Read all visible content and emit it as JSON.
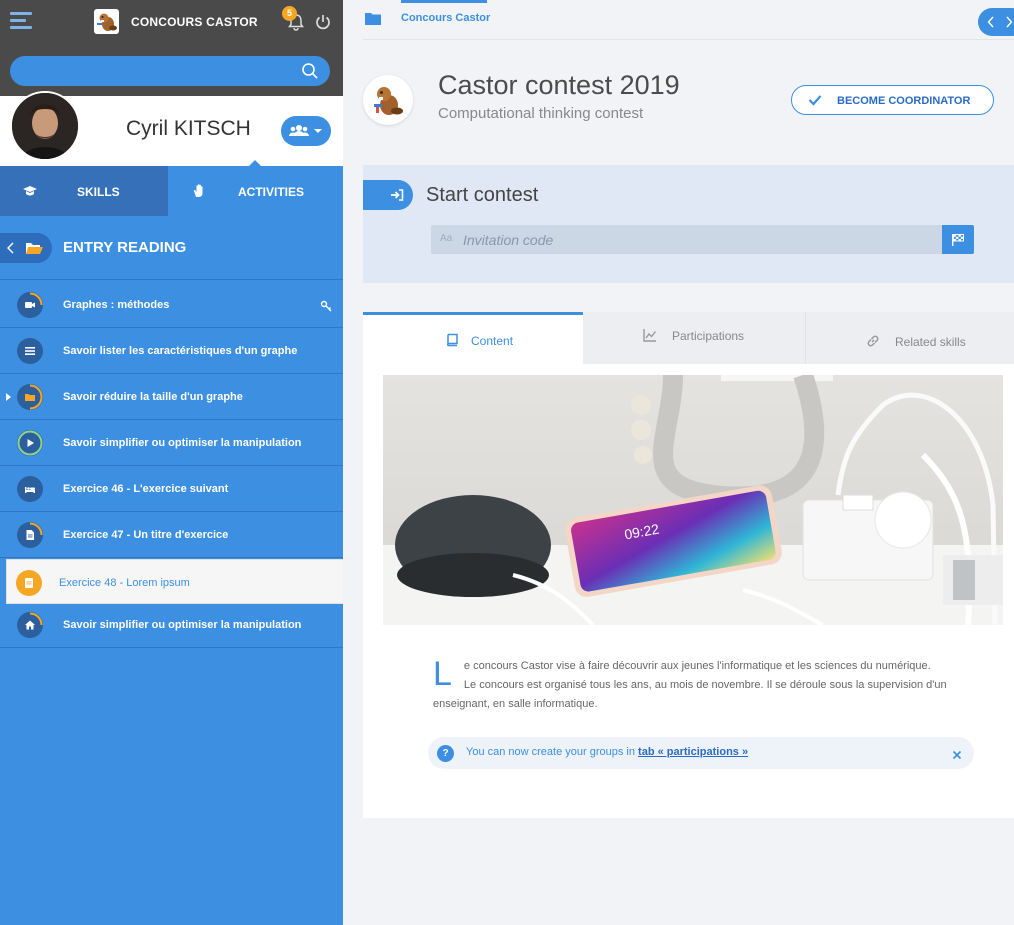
{
  "app": {
    "title": "CONCOURS CASTOR",
    "notification_count": "5"
  },
  "search": {
    "placeholder": ""
  },
  "user": {
    "name": "Cyril KITSCH"
  },
  "tabs": {
    "skills": "SKILLS",
    "activities": "ACTIVITIES"
  },
  "sidebar": {
    "section_title": "ENTRY READING",
    "items": [
      {
        "label": "Graphes : méthodes",
        "icon": "video-icon",
        "extra_icon": "key-icon",
        "progress": 0.25
      },
      {
        "label": "Savoir lister les caractéristiques d'un graphe",
        "icon": "list-icon",
        "progress": 0
      },
      {
        "label": "Savoir réduire la taille d'un graphe",
        "icon": "folder-icon",
        "progress": 0.5
      },
      {
        "label": "Savoir simplifier ou optimiser la manipulation",
        "icon": "play-icon",
        "progress": 1
      },
      {
        "label": "Exercice 46 - L'exercice suivant",
        "icon": "bed-icon",
        "progress": 0
      },
      {
        "label": "Exercice 47 - Un titre d'exercice",
        "icon": "document-icon",
        "progress": 0.25
      },
      {
        "label": "Exercice 48 - Lorem ipsum",
        "icon": "note-icon",
        "active": true
      },
      {
        "label": "Savoir simplifier ou optimiser la manipulation",
        "icon": "home-icon",
        "progress": 0.25
      }
    ]
  },
  "breadcrumb": {
    "current": "Concours Castor"
  },
  "contest": {
    "title": "Castor contest 2019",
    "subtitle": "Computational thinking contest",
    "coordinator_button": "BECOME COORDINATOR"
  },
  "start": {
    "title": "Start contest",
    "invitation_placeholder": "Invitation code",
    "aa_label": "Aa"
  },
  "content_tabs": {
    "content": "Content",
    "participations": "Participations",
    "related_skills": "Related skills"
  },
  "content": {
    "dropcap": "L",
    "paragraph_line1": "e concours Castor vise à faire découvrir aux jeunes l'informatique et les sciences du numérique.",
    "paragraph_line2": "Le concours est organisé tous les ans, au mois de novembre. Il se déroule sous la supervision d'un enseignant, en salle informatique."
  },
  "notice": {
    "icon": "?",
    "text": "You can now create your groups in ",
    "link": "tab « participations »"
  },
  "colors": {
    "accent": "#3c8fe1",
    "dark_bar": "#4a4a4a",
    "orange": "#f5a623",
    "green": "#8fd28f"
  }
}
